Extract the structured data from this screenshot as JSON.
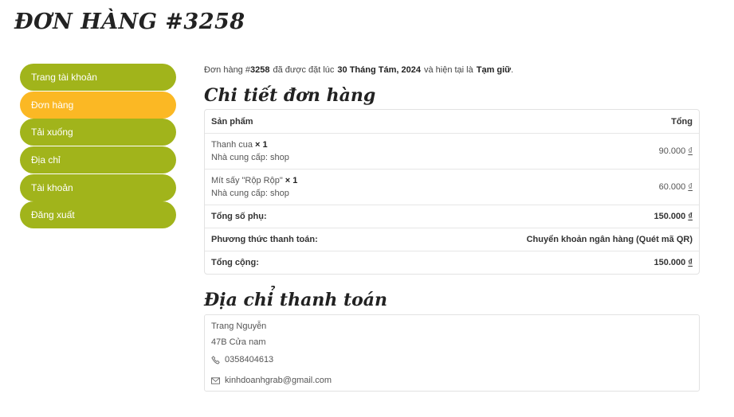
{
  "page": {
    "title": "ĐƠN HÀNG #3258"
  },
  "sidebar": {
    "items": [
      {
        "label": "Trang tài khoản"
      },
      {
        "label": "Đơn hàng"
      },
      {
        "label": "Tải xuống"
      },
      {
        "label": "Địa chỉ"
      },
      {
        "label": "Tài khoản"
      },
      {
        "label": "Đăng xuất"
      }
    ],
    "active_index": 1
  },
  "intro": {
    "prefix": "Đơn hàng #",
    "order_number": "3258",
    "mid": "đã được đặt lúc",
    "date": "30 Tháng Tám, 2024",
    "mid2": "và hiện tại là",
    "status": "Tạm giữ",
    "suffix": "."
  },
  "order_details": {
    "title": "Chi tiết đơn hàng",
    "head": {
      "product": "Sản phẩm",
      "total": "Tổng"
    },
    "items": [
      {
        "name": "Thanh cua",
        "qty": "× 1",
        "vendor": "Nhà cung cấp: shop",
        "amount": "90.000",
        "currency": "₫"
      },
      {
        "name": "Mít sấy \"Rộp Rộp\"",
        "qty": "× 1",
        "vendor": "Nhà cung cấp: shop",
        "amount": "60.000",
        "currency": "₫"
      }
    ],
    "subtotal": {
      "label": "Tổng số phụ:",
      "amount": "150.000",
      "currency": "₫"
    },
    "payment": {
      "label": "Phương thức thanh toán:",
      "value": "Chuyển khoản ngân hàng (Quét mã QR)"
    },
    "total": {
      "label": "Tổng cộng:",
      "amount": "150.000",
      "currency": "₫"
    }
  },
  "billing": {
    "title": "Địa chỉ thanh toán",
    "name": "Trang Nguyễn",
    "address": "47B Cửa nam",
    "phone": "0358404613",
    "email": "kinhdoanhgrab@gmail.com"
  },
  "colors": {
    "nav": "#a1b41b",
    "nav_active": "#fbb824"
  }
}
